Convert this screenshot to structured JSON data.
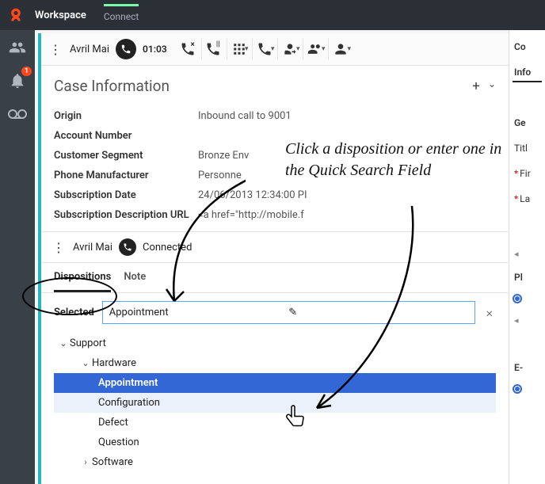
{
  "topbar": {
    "title": "Workspace",
    "connect": "Connect"
  },
  "sidebar": {
    "badge": "1"
  },
  "toolbar": {
    "name": "Avril Mai",
    "timer": "01:03"
  },
  "card": {
    "title": "Case Information",
    "rows": {
      "origin_k": "Origin",
      "origin_v": "Inbound call to 9001",
      "account_k": "Account Number",
      "account_v": "",
      "segment_k": "Customer Segment",
      "segment_v": "Bronze Env",
      "manuf_k": "Phone Manufacturer",
      "manuf_v": "Personne",
      "subdate_k": "Subscription Date",
      "subdate_v": "24/06/2013 12:34:00 PI",
      "suburl_k": "Subscription Description URL",
      "suburl_v": "<a href=\"http://mobile.f"
    }
  },
  "status": {
    "name": "Avril Mai",
    "state": "Connected"
  },
  "tabs": {
    "dispositions": "Dispositions",
    "note": "Note"
  },
  "disposition": {
    "selected_label": "Selected",
    "selected_value": "Appointment",
    "tree": {
      "support": "Support",
      "hardware": "Hardware",
      "appointment": "Appointment",
      "configuration": "Configuration",
      "defect": "Defect",
      "question": "Question",
      "software": "Software"
    }
  },
  "right": {
    "co": "Co",
    "info": "Info",
    "ge": "Ge",
    "title": "Titl",
    "first": "Fir",
    "last": "La",
    "ph": "Pl",
    "em": "E-"
  },
  "annotation": {
    "text": "Click a disposition or enter one in the Quick Search Field"
  }
}
